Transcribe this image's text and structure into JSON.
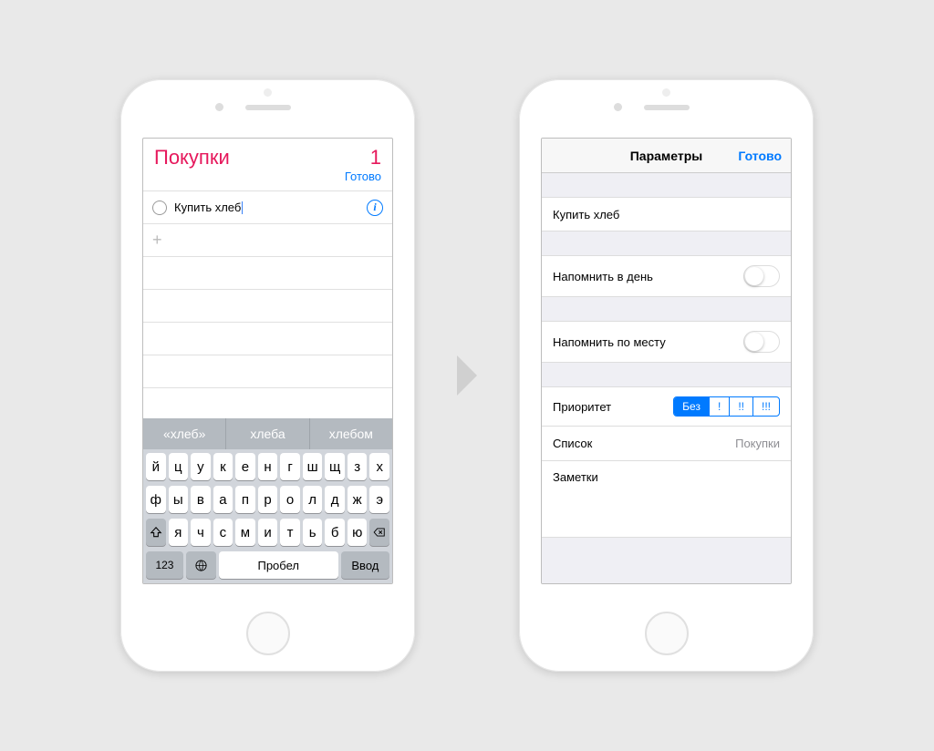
{
  "screenA": {
    "title": "Покупки",
    "count": "1",
    "done": "Готово",
    "item": "Купить хлеб",
    "suggestions": [
      "«хлеб»",
      "хлеба",
      "хлебом"
    ],
    "keyboard": {
      "row1": [
        "й",
        "ц",
        "у",
        "к",
        "е",
        "н",
        "г",
        "ш",
        "щ",
        "з",
        "х"
      ],
      "row2": [
        "ф",
        "ы",
        "в",
        "а",
        "п",
        "р",
        "о",
        "л",
        "д",
        "ж",
        "э"
      ],
      "row3": [
        "я",
        "ч",
        "с",
        "м",
        "и",
        "т",
        "ь",
        "б",
        "ю"
      ],
      "numKey": "123",
      "space": "Пробел",
      "enter": "Ввод"
    }
  },
  "screenB": {
    "navTitle": "Параметры",
    "done": "Готово",
    "item": "Купить хлеб",
    "remindDay": "Напомнить в день",
    "remindPlace": "Напомнить по месту",
    "priorityLabel": "Приоритет",
    "priorityOptions": [
      "Без",
      "!",
      "!!",
      "!!!"
    ],
    "listLabel": "Список",
    "listValue": "Покупки",
    "notesLabel": "Заметки"
  }
}
